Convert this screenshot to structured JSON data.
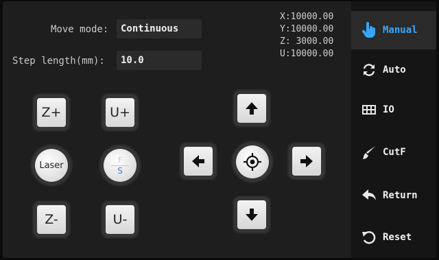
{
  "settings": {
    "move_mode_label": "Move mode:",
    "move_mode_value": "Continuous",
    "step_length_label": "Step length(mm):",
    "step_length_value": "10.0"
  },
  "coords": {
    "x": "X:10000.00",
    "y": "Y:10000.00",
    "z": "Z: 3000.00",
    "u": "U:10000.00"
  },
  "buttons": {
    "z_plus": "Z+",
    "u_plus": "U+",
    "laser": "Laser",
    "fs_f": "F",
    "fs_s": "S",
    "z_minus": "Z-",
    "u_minus": "U-"
  },
  "sidebar": {
    "items": [
      {
        "label": "Manual",
        "icon": "hand-pointer-icon",
        "active": true
      },
      {
        "label": "Auto",
        "icon": "refresh-icon"
      },
      {
        "label": "IO",
        "icon": "grid-icon"
      },
      {
        "label": "CutF",
        "icon": "brush-icon"
      },
      {
        "label": "Return",
        "icon": "return-arrow-icon"
      },
      {
        "label": "Reset",
        "icon": "reset-icon"
      }
    ]
  },
  "colors": {
    "accent": "#35a7ff",
    "background": "#1e1e1e"
  }
}
